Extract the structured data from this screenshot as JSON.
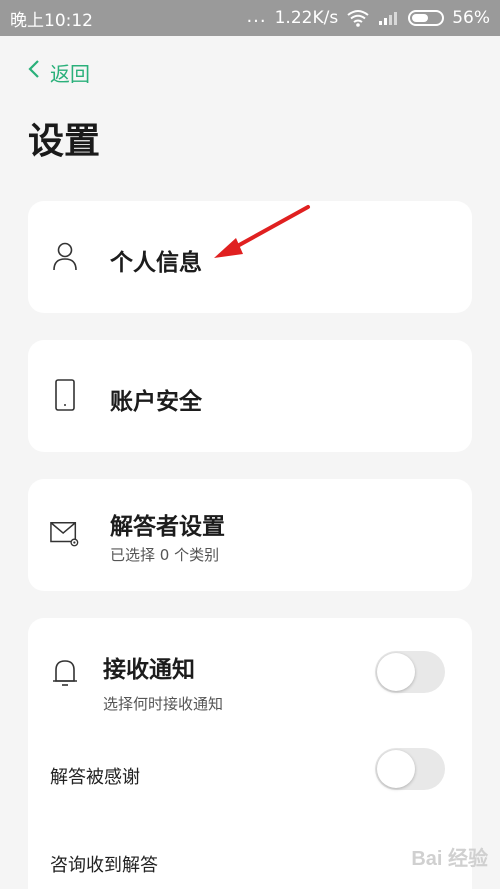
{
  "status_bar": {
    "time": "晚上10:12",
    "dots": "...",
    "net_speed": "1.22K/s",
    "battery": "56%"
  },
  "nav": {
    "back_label": "返回"
  },
  "page": {
    "title": "设置"
  },
  "menu": {
    "personal_info": "个人信息",
    "account_security": "账户安全",
    "answerer_settings": "解答者设置",
    "answerer_settings_sub": "已选择 0 个类别"
  },
  "notifications": {
    "title": "接收通知",
    "subtitle": "选择何时接收通知",
    "receive_enabled": false,
    "answer_thanked": "解答被感谢",
    "answer_thanked_enabled": false,
    "inquiry_answered": "咨询收到解答"
  },
  "watermark": "Bai 经验",
  "colors": {
    "accent": "#2ab07a",
    "arrow": "#e02020",
    "status_bar": "#9a9a9a"
  },
  "icons": [
    "back-chevron-icon",
    "wifi-icon",
    "signal-icon",
    "battery-icon",
    "person-icon",
    "phone-icon",
    "mail-gear-icon",
    "bell-icon"
  ]
}
